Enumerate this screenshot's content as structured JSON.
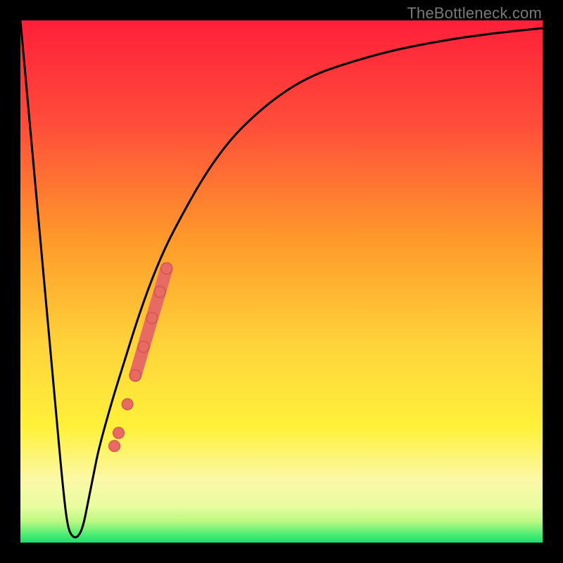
{
  "watermark": {
    "text": "TheBottleneck.com"
  },
  "colors": {
    "frame": "#000000",
    "grad_top": "#ff1f3a",
    "grad_mid1": "#ff8a2a",
    "grad_mid2": "#ffe13a",
    "grad_pale": "#fff9b0",
    "grad_bottom": "#18e06a",
    "curve": "#000000",
    "marker_fill": "#e76a63",
    "marker_stroke": "#c94b44"
  },
  "chart_data": {
    "type": "line",
    "title": "",
    "xlabel": "",
    "ylabel": "",
    "xlim": [
      0,
      100
    ],
    "ylim": [
      0,
      100
    ],
    "series": [
      {
        "name": "bottleneck-curve",
        "x": [
          0,
          1,
          2,
          3,
          4,
          5,
          6,
          7,
          8,
          9,
          10,
          11,
          12,
          13,
          14,
          15,
          17.5,
          20,
          22.5,
          25,
          27.5,
          30,
          35,
          40,
          45,
          50,
          55,
          60,
          70,
          80,
          90,
          100
        ],
        "y": [
          100,
          89,
          78,
          67,
          56,
          45,
          34,
          23,
          12,
          3,
          1,
          1,
          3,
          8,
          13,
          18,
          27,
          35,
          43,
          50,
          56,
          61,
          70,
          77,
          82,
          86,
          89,
          91,
          94,
          96,
          97.5,
          98.5
        ]
      }
    ],
    "markers": [
      {
        "x": 18.0,
        "y": 18.5
      },
      {
        "x": 18.8,
        "y": 21.0
      },
      {
        "x": 20.5,
        "y": 26.5
      },
      {
        "x": 22.0,
        "y": 32.0
      },
      {
        "x": 23.6,
        "y": 37.5
      },
      {
        "x": 25.2,
        "y": 43.0
      },
      {
        "x": 26.7,
        "y": 48.0
      },
      {
        "x": 28.0,
        "y": 52.5
      }
    ],
    "marker_radius": 8,
    "grid": false,
    "legend": false
  }
}
